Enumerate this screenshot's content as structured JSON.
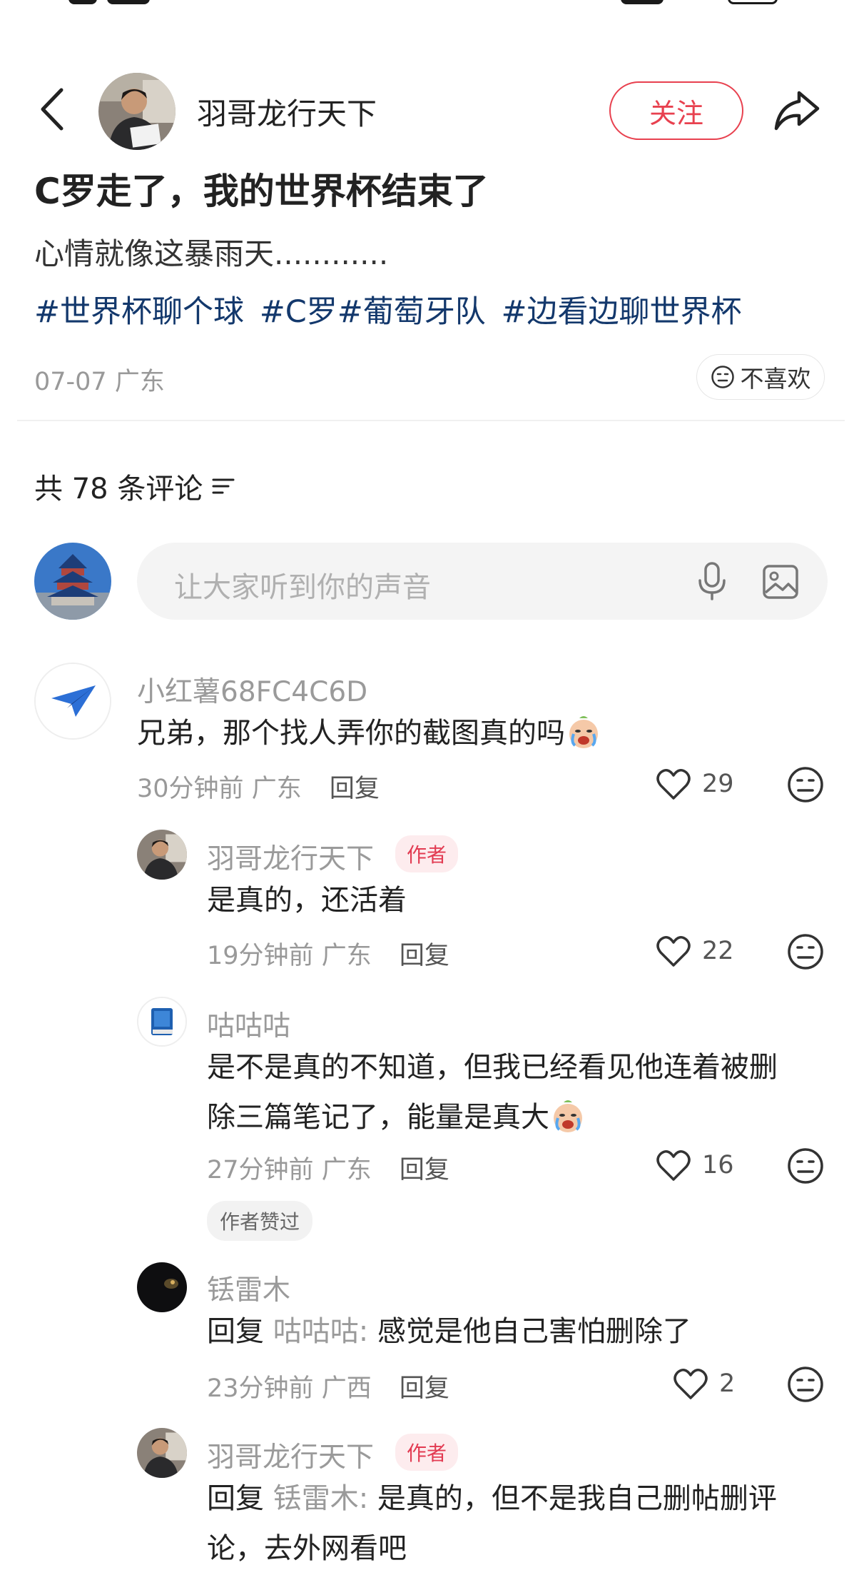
{
  "header": {
    "author_name": "羽哥龙行天下",
    "follow_label": "关注"
  },
  "post": {
    "title": "C罗走了，我的世界杯结束了",
    "body": "心情就像这暴雨天............",
    "hashtags": [
      "#世界杯聊个球",
      "#C罗#葡萄牙队",
      "#边看边聊世界杯"
    ],
    "date": "07-07",
    "location": "广东",
    "dislike_label": "不喜欢"
  },
  "comments_section": {
    "count_label": "共 78 条评论",
    "input_placeholder": "让大家听到你的声音"
  },
  "comments": [
    {
      "name": "小红薯68FC4C6D",
      "text": "兄弟，那个找人弄你的截图真的吗",
      "emoji": "cry-laugh-emoji",
      "time": "30分钟前",
      "location": "广东",
      "reply_label": "回复",
      "likes": "29"
    },
    {
      "name": "羽哥龙行天下",
      "author_tag": "作者",
      "text": "是真的，还活着",
      "time": "19分钟前",
      "location": "广东",
      "reply_label": "回复",
      "likes": "22"
    },
    {
      "name": "咕咕咕",
      "text_line1": "是不是真的不知道，但我已经看见他连着被删",
      "text_line2": "除三篇笔记了，能量是真大",
      "emoji": "cry-laugh-emoji",
      "time": "27分钟前",
      "location": "广东",
      "reply_label": "回复",
      "likes": "16",
      "badge": "作者赞过"
    },
    {
      "name": "铥雷木",
      "reply_prefix": "回复",
      "mention": "咕咕咕:",
      "text": "感觉是他自己害怕删除了",
      "time": "23分钟前",
      "location": "广西",
      "reply_label": "回复",
      "likes": "2"
    },
    {
      "name": "羽哥龙行天下",
      "author_tag": "作者",
      "reply_prefix": "回复",
      "mention": "铥雷木:",
      "text_line1": "是真的，但不是我自己删帖删评",
      "text_line2": "论，去外网看吧"
    }
  ],
  "colors": {
    "accent": "#e8414f",
    "hashtag": "#13386c",
    "muted": "#999999"
  }
}
